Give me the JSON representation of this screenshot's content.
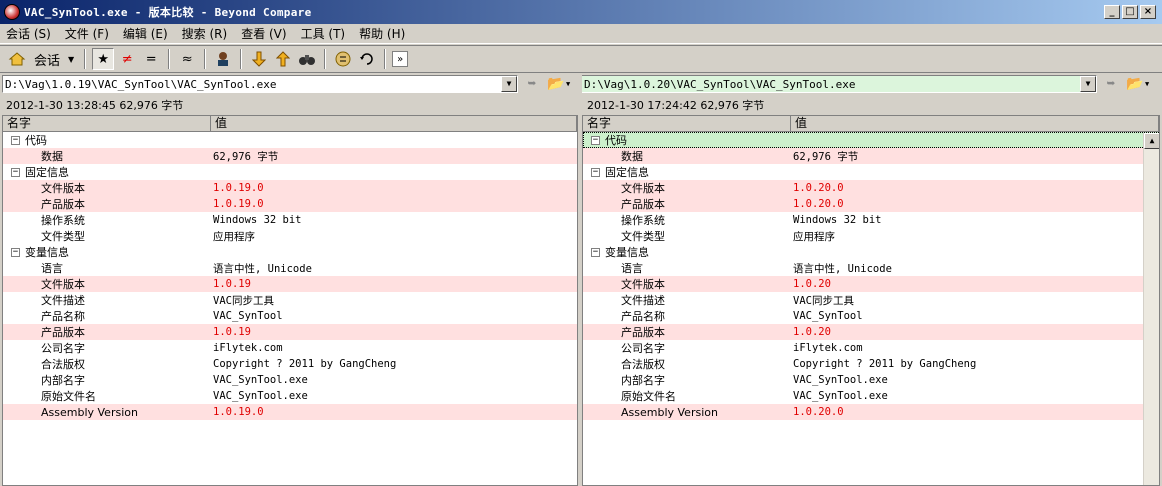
{
  "window": {
    "title": "VAC_SynTool.exe - 版本比较 - Beyond Compare",
    "buttons": {
      "minimize": "_",
      "maximize": "□",
      "close": "×"
    }
  },
  "menu": [
    {
      "label": "会话 (S)"
    },
    {
      "label": "文件 (F)"
    },
    {
      "label": "编辑 (E)"
    },
    {
      "label": "搜索 (R)"
    },
    {
      "label": "查看 (V)"
    },
    {
      "label": "工具 (T)"
    },
    {
      "label": "帮助 (H)"
    }
  ],
  "toolbar": {
    "session_label": "会话",
    "show_all": "★",
    "show_diff": "≠",
    "show_same": "=",
    "minor": "≈",
    "more": "»"
  },
  "left": {
    "path": "D:\\Vag\\1.0.19\\VAC_SynTool\\VAC_SynTool.exe",
    "info": "2012-1-30 13:28:45   62,976 字节"
  },
  "right": {
    "path": "D:\\Vag\\1.0.20\\VAC_SynTool\\VAC_SynTool.exe",
    "info": "2012-1-30 17:24:42   62,976 字节"
  },
  "columns": {
    "name": "名字",
    "value": "值"
  },
  "rows_left": [
    {
      "level": 0,
      "name": "代码",
      "value": "",
      "diff": false,
      "group": true
    },
    {
      "level": 1,
      "name": "数据",
      "value": "62,976 字节",
      "diff": true
    },
    {
      "level": 0,
      "name": "固定信息",
      "value": "",
      "diff": false,
      "group": true
    },
    {
      "level": 1,
      "name": "文件版本",
      "value": "1.0.19.0",
      "diff": true,
      "red": true
    },
    {
      "level": 1,
      "name": "产品版本",
      "value": "1.0.19.0",
      "diff": true,
      "red": true
    },
    {
      "level": 1,
      "name": "操作系统",
      "value": "Windows 32 bit",
      "diff": false
    },
    {
      "level": 1,
      "name": "文件类型",
      "value": "应用程序",
      "diff": false
    },
    {
      "level": 0,
      "name": "变量信息",
      "value": "",
      "diff": false,
      "group": true
    },
    {
      "level": 1,
      "name": "语言",
      "value": "语言中性, Unicode",
      "diff": false
    },
    {
      "level": 1,
      "name": "文件版本",
      "value": "1.0.19",
      "diff": true,
      "red": true
    },
    {
      "level": 1,
      "name": "文件描述",
      "value": "VAC同步工具",
      "diff": false
    },
    {
      "level": 1,
      "name": "产品名称",
      "value": "VAC_SynTool",
      "diff": false
    },
    {
      "level": 1,
      "name": "产品版本",
      "value": "1.0.19",
      "diff": true,
      "red": true
    },
    {
      "level": 1,
      "name": "公司名字",
      "value": "iFlytek.com",
      "diff": false
    },
    {
      "level": 1,
      "name": "合法版权",
      "value": "Copyright ?  2011 by GangCheng",
      "diff": false
    },
    {
      "level": 1,
      "name": "内部名字",
      "value": "VAC_SynTool.exe",
      "diff": false
    },
    {
      "level": 1,
      "name": "原始文件名",
      "value": "VAC_SynTool.exe",
      "diff": false
    },
    {
      "level": 1,
      "name": "Assembly Version",
      "value": "1.0.19.0",
      "diff": true,
      "red": true
    }
  ],
  "rows_right": [
    {
      "level": 0,
      "name": "代码",
      "value": "",
      "diff": false,
      "group": true,
      "selected": true
    },
    {
      "level": 1,
      "name": "数据",
      "value": "62,976 字节",
      "diff": true
    },
    {
      "level": 0,
      "name": "固定信息",
      "value": "",
      "diff": false,
      "group": true
    },
    {
      "level": 1,
      "name": "文件版本",
      "value": "1.0.20.0",
      "diff": true,
      "red": true
    },
    {
      "level": 1,
      "name": "产品版本",
      "value": "1.0.20.0",
      "diff": true,
      "red": true
    },
    {
      "level": 1,
      "name": "操作系统",
      "value": "Windows 32 bit",
      "diff": false
    },
    {
      "level": 1,
      "name": "文件类型",
      "value": "应用程序",
      "diff": false
    },
    {
      "level": 0,
      "name": "变量信息",
      "value": "",
      "diff": false,
      "group": true
    },
    {
      "level": 1,
      "name": "语言",
      "value": "语言中性, Unicode",
      "diff": false
    },
    {
      "level": 1,
      "name": "文件版本",
      "value": "1.0.20",
      "diff": true,
      "red": true
    },
    {
      "level": 1,
      "name": "文件描述",
      "value": "VAC同步工具",
      "diff": false
    },
    {
      "level": 1,
      "name": "产品名称",
      "value": "VAC_SynTool",
      "diff": false
    },
    {
      "level": 1,
      "name": "产品版本",
      "value": "1.0.20",
      "diff": true,
      "red": true
    },
    {
      "level": 1,
      "name": "公司名字",
      "value": "iFlytek.com",
      "diff": false
    },
    {
      "level": 1,
      "name": "合法版权",
      "value": "Copyright ?  2011 by GangCheng",
      "diff": false
    },
    {
      "level": 1,
      "name": "内部名字",
      "value": "VAC_SynTool.exe",
      "diff": false
    },
    {
      "level": 1,
      "name": "原始文件名",
      "value": "VAC_SynTool.exe",
      "diff": false
    },
    {
      "level": 1,
      "name": "Assembly Version",
      "value": "1.0.20.0",
      "diff": true,
      "red": true
    }
  ],
  "colors": {
    "diff_row": "#ffe0e0",
    "diff_text": "#e00000",
    "selected_row": "#ccf0cc"
  }
}
